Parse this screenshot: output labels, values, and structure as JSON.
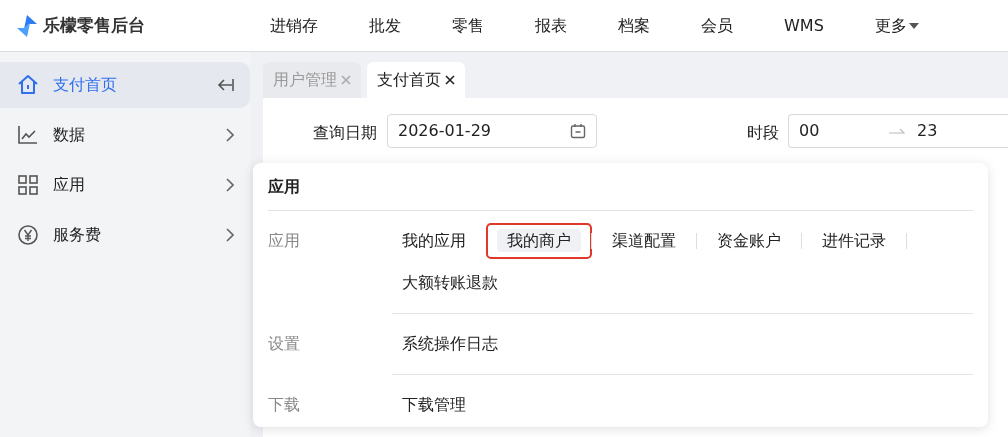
{
  "app": {
    "title": "乐檬零售后台"
  },
  "top_nav": [
    {
      "label": "进销存",
      "dropdown": false
    },
    {
      "label": "批发",
      "dropdown": false
    },
    {
      "label": "零售",
      "dropdown": false
    },
    {
      "label": "报表",
      "dropdown": false
    },
    {
      "label": "档案",
      "dropdown": false
    },
    {
      "label": "会员",
      "dropdown": false
    },
    {
      "label": "WMS",
      "dropdown": false
    },
    {
      "label": "更多",
      "dropdown": true
    }
  ],
  "sidebar": {
    "items": [
      {
        "label": "支付首页",
        "selected": true
      },
      {
        "label": "数据",
        "selected": false
      },
      {
        "label": "应用",
        "selected": false
      },
      {
        "label": "服务费",
        "selected": false
      }
    ]
  },
  "tabs": [
    {
      "label": "用户管理",
      "selected": false
    },
    {
      "label": "支付首页",
      "selected": true
    }
  ],
  "filters": {
    "date": {
      "label": "查询日期",
      "value": "2026-01-29"
    },
    "period": {
      "label": "时段",
      "start": "00",
      "end": "23"
    }
  },
  "popup": {
    "title": "应用",
    "sections": [
      {
        "label": "应用",
        "items": [
          {
            "label": "我的应用",
            "highlighted": false
          },
          {
            "label": "我的商户",
            "highlighted": true
          },
          {
            "label": "渠道配置",
            "highlighted": false
          },
          {
            "label": "资金账户",
            "highlighted": false
          },
          {
            "label": "进件记录",
            "highlighted": false
          },
          {
            "label": "大额转账退款",
            "highlighted": false
          }
        ]
      },
      {
        "label": "设置",
        "items": [
          {
            "label": "系统操作日志",
            "highlighted": false
          }
        ]
      },
      {
        "label": "下载",
        "items": [
          {
            "label": "下载管理",
            "highlighted": false
          }
        ]
      }
    ]
  }
}
